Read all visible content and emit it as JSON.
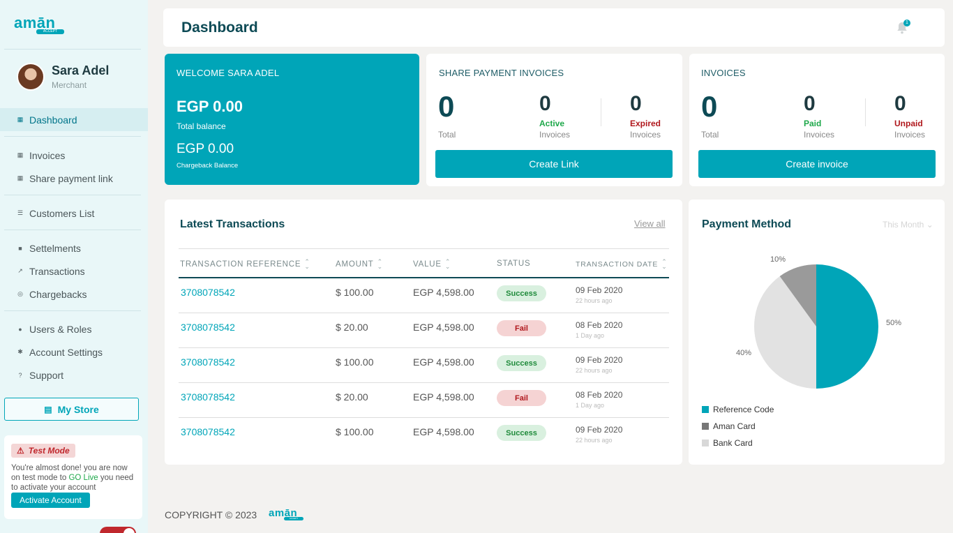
{
  "brand": {
    "logo_text": "amān",
    "logo_tag": "ACCEPT",
    "color": "#00a5b8"
  },
  "profile": {
    "name": "Sara Adel",
    "role": "Merchant"
  },
  "sidebar": {
    "items": [
      {
        "label": "Dashboard",
        "icon": "grid-icon",
        "active": true
      },
      {
        "label": "Invoices",
        "icon": "grid-icon"
      },
      {
        "label": "Share payment link",
        "icon": "grid-icon"
      },
      {
        "label": "Customers List",
        "icon": "list-icon"
      },
      {
        "label": "Settelments",
        "icon": "folder-icon"
      },
      {
        "label": "Transactions",
        "icon": "trend-icon"
      },
      {
        "label": "Chargebacks",
        "icon": "target-icon"
      },
      {
        "label": "Users & Roles",
        "icon": "users-icon"
      },
      {
        "label": "Account Settings",
        "icon": "gear-icon"
      },
      {
        "label": "Support",
        "icon": "help-icon"
      }
    ],
    "my_store": "My Store",
    "test_mode": {
      "badge": "Test Mode",
      "text_before": "You're almost done! you are now on test mode to ",
      "go_live": "GO Live",
      "text_after": " you need to activate your account",
      "activate": "Activate Account"
    }
  },
  "header": {
    "title": "Dashboard",
    "notifications": "1"
  },
  "welcome": {
    "title": "WELCOME SARA ADEL",
    "total_balance": "EGP 0.00",
    "total_balance_label": "Total balance",
    "chargeback_balance": "EGP 0.00",
    "chargeback_label": "Chargeback Balance"
  },
  "share_card": {
    "title": "SHARE PAYMENT INVOICES",
    "total": "0",
    "total_label": "Total",
    "active": "0",
    "active_label": "Active",
    "active_sub": "Invoices",
    "expired": "0",
    "expired_label": "Expired",
    "expired_sub": "Invoices",
    "button": "Create Link"
  },
  "invoice_card": {
    "title": "INVOICES",
    "total": "0",
    "total_label": "Total",
    "paid": "0",
    "paid_label": "Paid",
    "paid_sub": "Invoices",
    "unpaid": "0",
    "unpaid_label": "Unpaid",
    "unpaid_sub": "Invoices",
    "button": "Create invoice"
  },
  "transactions": {
    "title": "Latest Transactions",
    "view_all": "View all",
    "columns": [
      "TRANSACTION REFERENCE",
      "AMOUNT",
      "VALUE",
      "STATUS",
      "TRANSACTION DATE"
    ],
    "rows": [
      {
        "ref": "3708078542",
        "amount": "$ 100.00",
        "value": "EGP 4,598.00",
        "status": "Success",
        "date": "09 Feb 2020",
        "ago": "22 hours ago"
      },
      {
        "ref": "3708078542",
        "amount": "$ 20.00",
        "value": "EGP 4,598.00",
        "status": "Fail",
        "date": "08 Feb 2020",
        "ago": "1 Day ago"
      },
      {
        "ref": "3708078542",
        "amount": "$ 100.00",
        "value": "EGP 4,598.00",
        "status": "Success",
        "date": "09 Feb 2020",
        "ago": "22 hours ago"
      },
      {
        "ref": "3708078542",
        "amount": "$ 20.00",
        "value": "EGP 4,598.00",
        "status": "Fail",
        "date": "08 Feb 2020",
        "ago": "1 Day ago"
      },
      {
        "ref": "3708078542",
        "amount": "$ 100.00",
        "value": "EGP 4,598.00",
        "status": "Success",
        "date": "09 Feb 2020",
        "ago": "22 hours ago"
      }
    ]
  },
  "payment_method": {
    "title": "Payment Method",
    "filter": "This Month"
  },
  "chart_data": {
    "type": "pie",
    "categories": [
      "Reference Code",
      "Aman Card",
      "Bank Card"
    ],
    "values": [
      50,
      10,
      40
    ],
    "labels": [
      "50%",
      "10%",
      "40%"
    ],
    "colors": [
      "#00a5b8",
      "#9a9a9a",
      "#e2e2e2"
    ],
    "legend_colors": [
      "#00a5b8",
      "#777777",
      "#d8d8d8"
    ],
    "legend": "bottom"
  },
  "footer": {
    "copyright": "COPYRIGHT © 2023"
  }
}
